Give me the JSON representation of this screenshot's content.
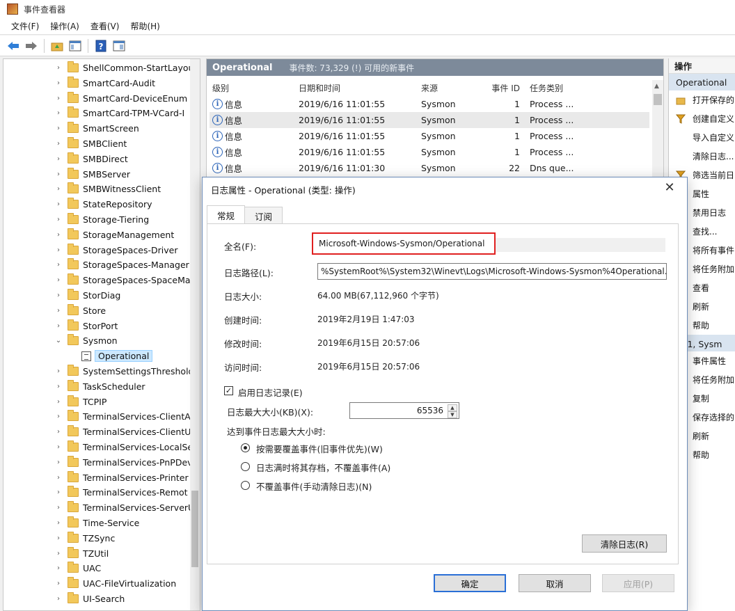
{
  "window": {
    "title": "事件查看器"
  },
  "menu": [
    "文件(F)",
    "操作(A)",
    "查看(V)",
    "帮助(H)"
  ],
  "toolbar": {
    "icons": [
      "back-arrow-icon",
      "forward-arrow-icon",
      "folder-up-icon",
      "console-tree-icon",
      "help-icon",
      "show-pane-icon"
    ]
  },
  "tree": {
    "items": [
      {
        "label": "ShellCommon-StartLayou",
        "arrow": "›"
      },
      {
        "label": "SmartCard-Audit",
        "arrow": "›"
      },
      {
        "label": "SmartCard-DeviceEnum",
        "arrow": "›"
      },
      {
        "label": "SmartCard-TPM-VCard-I",
        "arrow": "›"
      },
      {
        "label": "SmartScreen",
        "arrow": "›"
      },
      {
        "label": "SMBClient",
        "arrow": "›"
      },
      {
        "label": "SMBDirect",
        "arrow": "›"
      },
      {
        "label": "SMBServer",
        "arrow": "›"
      },
      {
        "label": "SMBWitnessClient",
        "arrow": "›"
      },
      {
        "label": "StateRepository",
        "arrow": "›"
      },
      {
        "label": "Storage-Tiering",
        "arrow": "›"
      },
      {
        "label": "StorageManagement",
        "arrow": "›"
      },
      {
        "label": "StorageSpaces-Driver",
        "arrow": "›"
      },
      {
        "label": "StorageSpaces-Manager",
        "arrow": "›"
      },
      {
        "label": "StorageSpaces-SpaceMa",
        "arrow": "›"
      },
      {
        "label": "StorDiag",
        "arrow": "›"
      },
      {
        "label": "Store",
        "arrow": "›"
      },
      {
        "label": "StorPort",
        "arrow": "›"
      },
      {
        "label": "Sysmon",
        "arrow": "⌄"
      },
      {
        "label": "Operational",
        "child": true
      },
      {
        "label": "SystemSettingsThreshold",
        "arrow": "›"
      },
      {
        "label": "TaskScheduler",
        "arrow": "›"
      },
      {
        "label": "TCPIP",
        "arrow": "›"
      },
      {
        "label": "TerminalServices-ClientA",
        "arrow": "›"
      },
      {
        "label": "TerminalServices-ClientU",
        "arrow": "›"
      },
      {
        "label": "TerminalServices-LocalSe",
        "arrow": "›"
      },
      {
        "label": "TerminalServices-PnPDev",
        "arrow": "›"
      },
      {
        "label": "TerminalServices-Printer",
        "arrow": "›"
      },
      {
        "label": "TerminalServices-Remot",
        "arrow": "›"
      },
      {
        "label": "TerminalServices-ServerU",
        "arrow": "›"
      },
      {
        "label": "Time-Service",
        "arrow": "›"
      },
      {
        "label": "TZSync",
        "arrow": "›"
      },
      {
        "label": "TZUtil",
        "arrow": "›"
      },
      {
        "label": "UAC",
        "arrow": "›"
      },
      {
        "label": "UAC-FileVirtualization",
        "arrow": "›"
      },
      {
        "label": "UI-Search",
        "arrow": "›"
      }
    ]
  },
  "events": {
    "title": "Operational",
    "count_text": "事件数: 73,329 (!) 可用的新事件",
    "columns": [
      "级别",
      "日期和时间",
      "来源",
      "事件 ID",
      "任务类别"
    ],
    "rows": [
      {
        "level": "信息",
        "date": "2019/6/16 11:01:55",
        "source": "Sysmon",
        "id": "1",
        "task": "Process ..."
      },
      {
        "level": "信息",
        "date": "2019/6/16 11:01:55",
        "source": "Sysmon",
        "id": "1",
        "task": "Process ..."
      },
      {
        "level": "信息",
        "date": "2019/6/16 11:01:55",
        "source": "Sysmon",
        "id": "1",
        "task": "Process ..."
      },
      {
        "level": "信息",
        "date": "2019/6/16 11:01:55",
        "source": "Sysmon",
        "id": "1",
        "task": "Process ..."
      },
      {
        "level": "信息",
        "date": "2019/6/16 11:01:30",
        "source": "Sysmon",
        "id": "22",
        "task": "Dns que..."
      }
    ]
  },
  "actions": {
    "header": "操作",
    "section1": "Operational",
    "items1": [
      {
        "label": "打开保存的",
        "icon": "open-folder-icon"
      },
      {
        "label": "创建自定义",
        "icon": "filter-icon"
      },
      {
        "label": "导入自定义",
        "icon": ""
      },
      {
        "label": "清除日志...",
        "icon": ""
      },
      {
        "label": "筛选当前日",
        "icon": "filter-icon"
      },
      {
        "label": "属性",
        "icon": ""
      },
      {
        "label": "禁用日志",
        "icon": ""
      },
      {
        "label": "查找...",
        "icon": ""
      },
      {
        "label": "将所有事件",
        "icon": ""
      },
      {
        "label": "将任务附加",
        "icon": ""
      },
      {
        "label": "查看",
        "icon": ""
      },
      {
        "label": "刷新",
        "icon": ""
      },
      {
        "label": "帮助",
        "icon": ""
      }
    ],
    "section2": "件 1, Sysm",
    "items2": [
      {
        "label": "事件属性"
      },
      {
        "label": "将任务附加"
      },
      {
        "label": "复制"
      },
      {
        "label": "保存选择的"
      },
      {
        "label": "刷新"
      },
      {
        "label": "帮助"
      }
    ]
  },
  "dialog": {
    "title": "日志属性 - Operational (类型: 操作)",
    "close": "✕",
    "tabs": [
      "常规",
      "订阅"
    ],
    "fullname_label": "全名(F):",
    "fullname_value": "Microsoft-Windows-Sysmon/Operational",
    "path_label": "日志路径(L):",
    "path_value": "%SystemRoot%\\System32\\Winevt\\Logs\\Microsoft-Windows-Sysmon%4Operational.e",
    "size_label": "日志大小:",
    "size_value": "64.00 MB(67,112,960 个字节)",
    "created_label": "创建时间:",
    "created_value": "2019年2月19日 1:47:03",
    "modified_label": "修改时间:",
    "modified_value": "2019年6月15日 20:57:06",
    "accessed_label": "访问时间:",
    "accessed_value": "2019年6月15日 20:57:06",
    "enable_label": "启用日志记录(E)",
    "enable_checked": true,
    "maxsize_label": "日志最大大小(KB)(X):",
    "maxsize_value": "65536",
    "when_full_label": "达到事件日志最大大小时:",
    "options": [
      {
        "label": "按需要覆盖事件(旧事件优先)(W)",
        "selected": true
      },
      {
        "label": "日志满时将其存档，不覆盖事件(A)",
        "selected": false
      },
      {
        "label": "不覆盖事件(手动清除日志)(N)",
        "selected": false
      }
    ],
    "clear_button": "清除日志(R)",
    "ok_button": "确定",
    "cancel_button": "取消",
    "apply_button": "应用(P)"
  }
}
